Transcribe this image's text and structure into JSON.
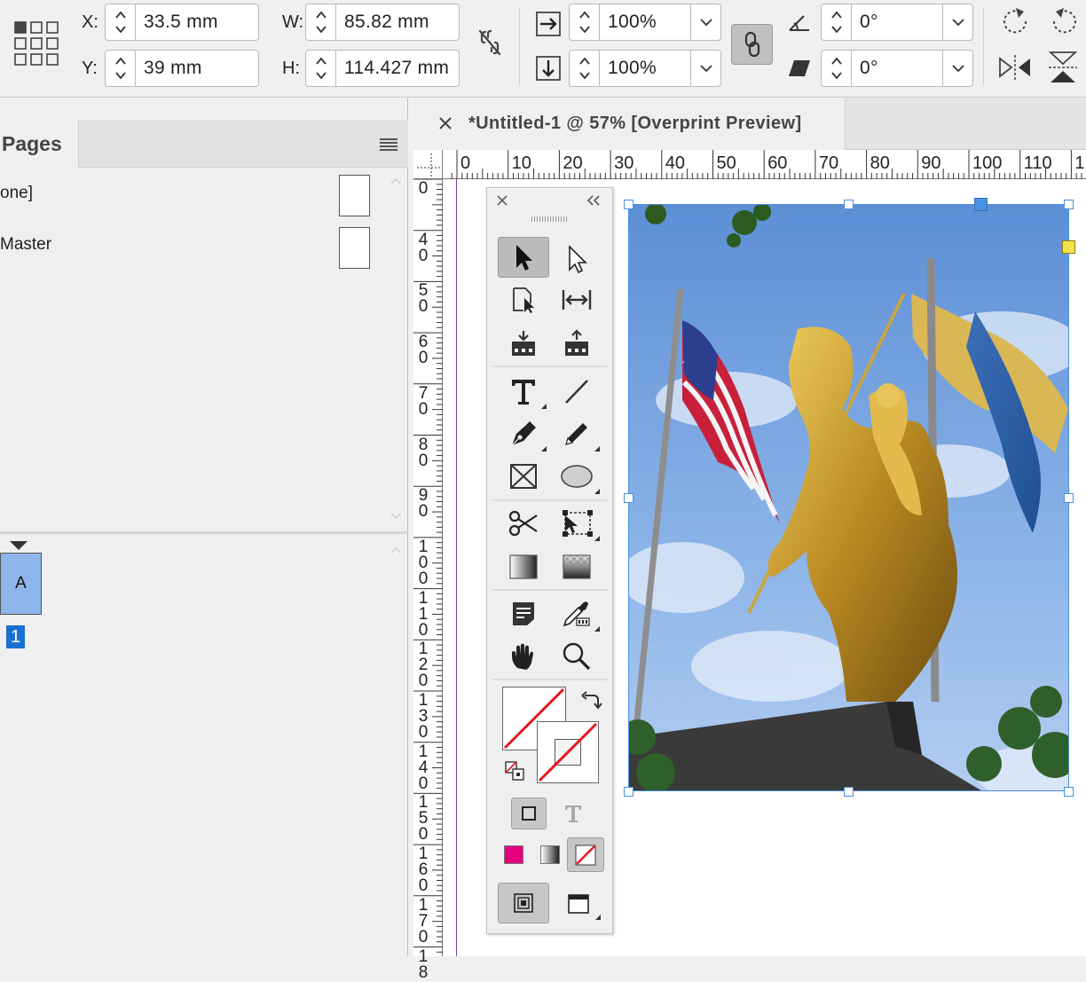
{
  "control_bar": {
    "x_label": "X:",
    "x_value": "33.5 mm",
    "y_label": "Y:",
    "y_value": "39 mm",
    "w_label": "W:",
    "w_value": "85.82 mm",
    "h_label": "H:",
    "h_value": "114.427 mm",
    "scale_x_value": "100%",
    "scale_y_value": "100%",
    "rotation_value": "0°",
    "shear_value": "0°"
  },
  "pages_panel": {
    "tab_label": "Pages",
    "rows": [
      {
        "label": "one]"
      },
      {
        "label": "Master"
      }
    ],
    "master_letter": "A",
    "page_number": "1"
  },
  "document": {
    "tab_title": "*Untitled-1 @ 57% [Overprint Preview]",
    "h_ruler_labels": [
      "0",
      "10",
      "20",
      "30",
      "40",
      "50",
      "60",
      "70",
      "80",
      "90",
      "100",
      "110",
      "1"
    ],
    "v_ruler_labels": [
      [
        "0"
      ],
      [
        "4",
        "0"
      ],
      [
        "5",
        "0"
      ],
      [
        "6",
        "0"
      ],
      [
        "7",
        "0"
      ],
      [
        "8",
        "0"
      ],
      [
        "9",
        "0"
      ],
      [
        "1",
        "0",
        "0"
      ],
      [
        "1",
        "1",
        "0"
      ],
      [
        "1",
        "2",
        "0"
      ],
      [
        "1",
        "3",
        "0"
      ],
      [
        "1",
        "4",
        "0"
      ],
      [
        "1",
        "5",
        "0"
      ],
      [
        "1",
        "6",
        "0"
      ],
      [
        "1",
        "7",
        "0"
      ],
      [
        "1",
        "8"
      ]
    ]
  },
  "colors": {
    "accent_blue": "#4a90e2",
    "selection_blue": "#1a6fd1",
    "master_page_fill": "#8fb6ea",
    "none_swatch_red": "#e8141c",
    "magenta_swatch": "#e5007d",
    "frame_point_yellow": "#f2e34a"
  },
  "tools": [
    "selection-tool",
    "direct-selection-tool",
    "page-tool",
    "gap-tool",
    "content-collector-tool",
    "content-placer-tool",
    "type-tool",
    "line-tool",
    "pen-tool",
    "pencil-tool",
    "rectangle-frame-tool",
    "ellipse-tool",
    "scissors-tool",
    "free-transform-tool",
    "gradient-swatch-tool",
    "gradient-feather-tool",
    "note-tool",
    "eyedropper-tool",
    "hand-tool",
    "zoom-tool"
  ]
}
